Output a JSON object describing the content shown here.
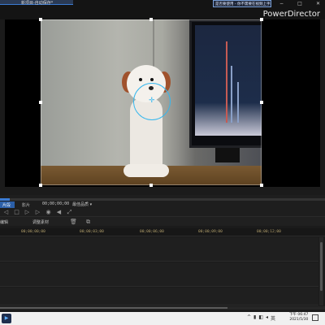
{
  "app": {
    "brand": "PowerDirector",
    "document_name": "新项目-自动保存*",
    "notice": "是否要使用 - 你不需要在视频上手机可以播放。"
  },
  "window_buttons": [
    "−",
    "□",
    "✕"
  ],
  "preview": {},
  "controls": {
    "mode_clip": "片段",
    "mode_film": "影片",
    "timecode": "00;00;00;00",
    "quality": "最佳品质 ▾",
    "progress_fraction": 0.03
  },
  "toolbar": {
    "left_label": "编辑",
    "middle_label": "调整素材"
  },
  "timeline": {
    "ticks": [
      "00;00;00;00",
      "00;00;03;00",
      "00;00;06;00",
      "00;00;09;00",
      "00;00;12;00"
    ]
  },
  "taskbar": {
    "time": "下午 06:47",
    "date": "2021/5/30"
  },
  "colors": {
    "accent": "#3b7bd4",
    "ring": "#35b7ee",
    "ruler_text": "#b3a06c"
  }
}
